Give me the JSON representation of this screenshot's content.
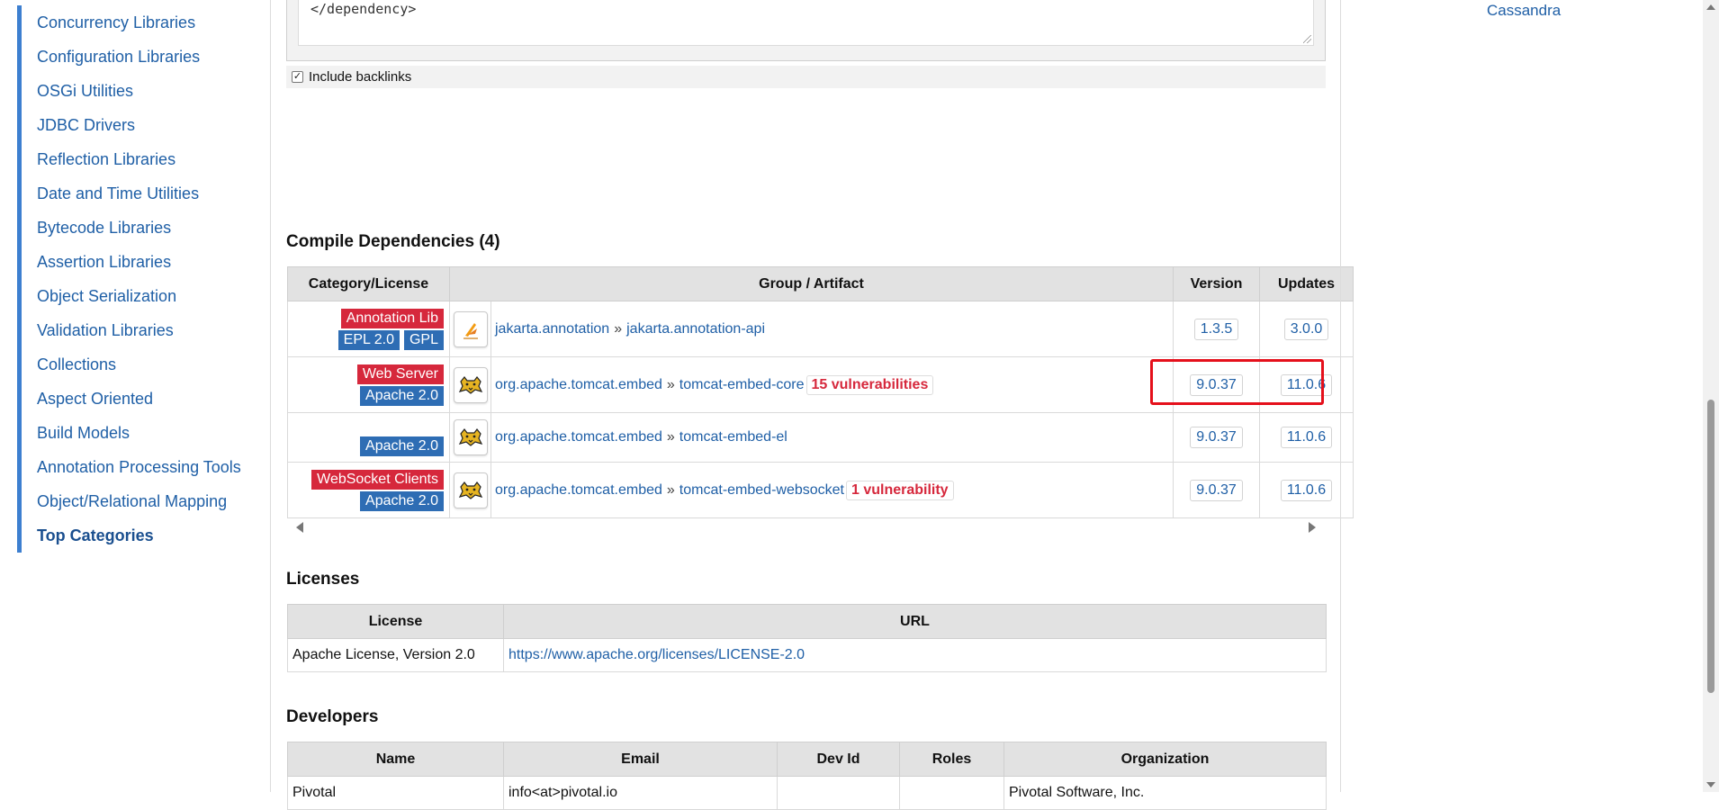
{
  "sidebar": {
    "items": [
      {
        "label": "Concurrency Libraries"
      },
      {
        "label": "Configuration Libraries"
      },
      {
        "label": "OSGi Utilities"
      },
      {
        "label": "JDBC Drivers"
      },
      {
        "label": "Reflection Libraries"
      },
      {
        "label": "Date and Time Utilities"
      },
      {
        "label": "Bytecode Libraries"
      },
      {
        "label": "Assertion Libraries"
      },
      {
        "label": "Object Serialization"
      },
      {
        "label": "Validation Libraries"
      },
      {
        "label": "Collections"
      },
      {
        "label": "Aspect Oriented"
      },
      {
        "label": "Build Models"
      },
      {
        "label": "Annotation Processing Tools"
      },
      {
        "label": "Object/Relational Mapping"
      },
      {
        "label": "Top Categories"
      }
    ]
  },
  "right_panel": {
    "link": "Cassandra"
  },
  "snippet": {
    "code_tail": "</dependency>",
    "include_backlinks_label": "Include backlinks",
    "include_backlinks_checked": true
  },
  "dependencies": {
    "title": "Compile Dependencies (4)",
    "headers": {
      "category": "Category/License",
      "artifact": "Group / Artifact",
      "version": "Version",
      "updates": "Updates"
    },
    "rows": [
      {
        "categories": [
          "Annotation Lib"
        ],
        "licenses": [
          "EPL 2.0",
          "GPL"
        ],
        "icon": "jakarta-icon",
        "group": "jakarta.annotation",
        "separator": "»",
        "artifact": "jakarta.annotation-api",
        "vulnerabilities": "",
        "version": "1.3.5",
        "update": "3.0.0"
      },
      {
        "categories": [
          "Web Server"
        ],
        "licenses": [
          "Apache 2.0"
        ],
        "icon": "tomcat-icon",
        "group": "org.apache.tomcat.embed",
        "separator": "»",
        "artifact": "tomcat-embed-core",
        "vulnerabilities": "15 vulnerabilities",
        "version": "9.0.37",
        "update": "11.0.6"
      },
      {
        "categories": [],
        "licenses": [
          "Apache 2.0"
        ],
        "icon": "tomcat-icon",
        "group": "org.apache.tomcat.embed",
        "separator": "»",
        "artifact": "tomcat-embed-el",
        "vulnerabilities": "",
        "version": "9.0.37",
        "update": "11.0.6"
      },
      {
        "categories": [
          "WebSocket Clients"
        ],
        "licenses": [
          "Apache 2.0"
        ],
        "icon": "tomcat-icon",
        "group": "org.apache.tomcat.embed",
        "separator": "»",
        "artifact": "tomcat-embed-websocket",
        "vulnerabilities": "1 vulnerability",
        "version": "9.0.37",
        "update": "11.0.6"
      }
    ]
  },
  "licenses": {
    "title": "Licenses",
    "headers": {
      "license": "License",
      "url": "URL"
    },
    "rows": [
      {
        "license": "Apache License, Version 2.0",
        "url": "https://www.apache.org/licenses/LICENSE-2.0"
      }
    ]
  },
  "developers": {
    "title": "Developers",
    "headers": {
      "name": "Name",
      "email": "Email",
      "dev_id": "Dev Id",
      "roles": "Roles",
      "organization": "Organization"
    },
    "rows": [
      {
        "name": "Pivotal",
        "email": "info<at>pivotal.io",
        "dev_id": "",
        "roles": "",
        "organization": "Pivotal Software, Inc."
      }
    ]
  },
  "colors": {
    "link": "#1f5fa6",
    "category_badge": "#d6283c",
    "license_badge": "#2e6db4",
    "vulnerability": "#d6283c",
    "highlight": "#e5101b",
    "header_bg": "#e2e2e2"
  }
}
